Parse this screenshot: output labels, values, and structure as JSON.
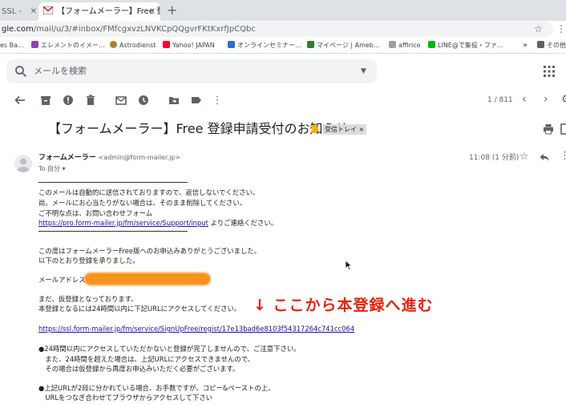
{
  "browser": {
    "tabs": [
      {
        "label": "SSL - "
      },
      {
        "label": "【フォームメーラー】Free 登録申"
      }
    ],
    "new_tab": "+",
    "url_prefix": "gle.com",
    "url_rest": "/mail/u/3/#inbox/FMfcgxvzLNVKCpQQgvrFKtKxrfJpCQbc",
    "bookmarks": [
      {
        "label": "es Ba...",
        "color": "#4285f4"
      },
      {
        "label": "エレメントのイメー...",
        "color": "#8e44ad"
      },
      {
        "label": "Astrodienst",
        "color": "#b07b2c"
      },
      {
        "label": "Yahoo! JAPAN",
        "color": "#ff0033"
      },
      {
        "label": "オンラインセミナー...",
        "color": "#3367d6"
      },
      {
        "label": "マイページ | Ameb...",
        "color": "#2e7d32"
      },
      {
        "label": "affirico",
        "color": "#9aa0a6"
      },
      {
        "label": "LINE@で集役・ファ...",
        "color": "#00b900"
      },
      {
        "label": "その他",
        "color": "#5f6368"
      }
    ]
  },
  "gmail": {
    "search_placeholder": "メールを検索",
    "pager": "1 / 811",
    "subject": "【フォームメーラー】Free 登録申請受付のお知らせ",
    "label_chip": "受信トレイ ×",
    "sender_name": "フォームメーラー",
    "sender_email": "<admin@form-mailer.jp>",
    "to_me": "To 自分 ▾",
    "time": "11:08 (1 分前)"
  },
  "body": {
    "l1": "このメールは自動的に送信されておりますので、返信しないでください。",
    "l2": "尚、メールにお心当たりがない場合は、そのまま削除してください。",
    "l3": "ご不明な点は、お問い合わせフォーム",
    "l4_link": "https://pro.form-mailer.jp/fm/service/Support/input",
    "l4_tail": " よりご連絡ください。",
    "l5": "この度はフォームメーラーFree版へのお申込みありがとうございました。",
    "l6": "以下のとおり登録を承りました。",
    "l7": "メールアドレス：",
    "l8": "まだ、仮登録となっております。",
    "l9": "本登録となるには24時間以内に下記URLにアクセスしてください。",
    "l10_link": "https://ssl.form-mailer.jp/fm/service/SignUpFree/regist/17e13bad6e8103f54317264c741cc064",
    "l11": "●24時間以内にアクセスしていただかないと登録が完了しませんので、ご注意下さい。",
    "l12": "　また、24時間を超えた場合は、上記URLにアクセスできませんので、",
    "l13": "　その場合は仮登録から再度お申込みいただく必要がございます。",
    "l14": "●上記URLが2段に分かれている場合、お手数ですが、コピー&ペーストの上、",
    "l15": "　URLをつなぎ合わせてブラウザからアクセスして下さい"
  },
  "annotation": "↓ ここから本登録へ進む",
  "colors": {
    "annotation": "#e8220c",
    "redaction": "#f7921e",
    "link": "#1a0dab"
  }
}
